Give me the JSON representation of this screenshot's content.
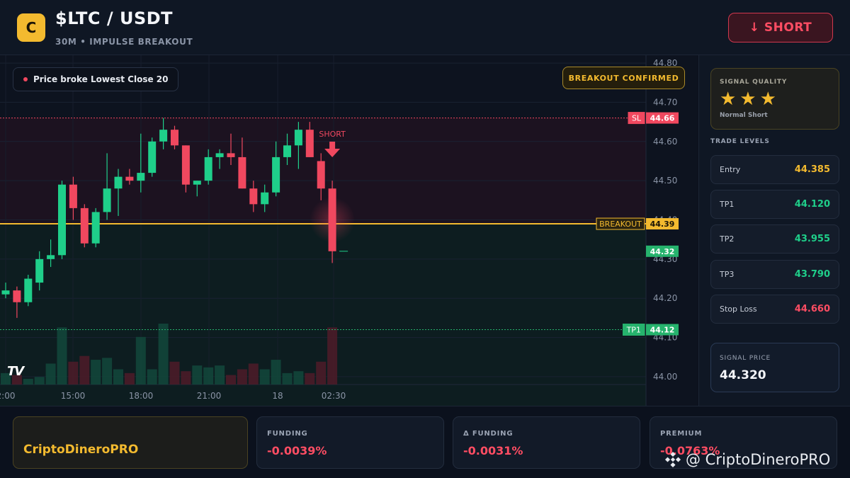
{
  "header": {
    "logo_letter": "C",
    "title": "$LTC / USDT",
    "subtitle": "30M • IMPULSE BREAKOUT",
    "short_button": "↓ SHORT"
  },
  "chart": {
    "signal_badge": "Price broke Lowest Close 20",
    "confirmed_badge": "BREAKOUT CONFIRMED",
    "short_marker": "SHORT",
    "tv_logo": "TV",
    "markers": [
      {
        "label": "SL",
        "value": "44.66",
        "color": "#f0485f"
      },
      {
        "label": "BREAKOUT",
        "value": "44.39",
        "color": "#f3ba2f"
      },
      {
        "label": "",
        "value": "44.32",
        "color": "#26b36d"
      },
      {
        "label": "TP1",
        "value": "44.12",
        "color": "#26b36d"
      }
    ],
    "colors": {
      "up": "#1fcf8a",
      "down": "#f0485f",
      "breakout": "#f3ba2f",
      "sl": "#f0485f",
      "tp": "#26b36d"
    }
  },
  "chart_data": {
    "type": "candlestick",
    "y_ticks": [
      "44.80",
      "44.70",
      "44.60",
      "44.50",
      "44.40",
      "44.30",
      "44.20",
      "44.10",
      "44.00"
    ],
    "ylim": [
      43.98,
      44.82
    ],
    "x_tick_labels": [
      "2:00",
      "15:00",
      "18:00",
      "21:00",
      "18",
      "02:30"
    ],
    "levels": {
      "stop_loss": 44.66,
      "breakout": 44.39,
      "last_price": 44.32,
      "tp1": 44.12
    },
    "candles": [
      {
        "o": 44.21,
        "h": 44.24,
        "l": 44.2,
        "c": 44.22
      },
      {
        "o": 44.22,
        "h": 44.23,
        "l": 44.15,
        "c": 44.19
      },
      {
        "o": 44.19,
        "h": 44.26,
        "l": 44.18,
        "c": 44.25
      },
      {
        "o": 44.24,
        "h": 44.32,
        "l": 44.22,
        "c": 44.3
      },
      {
        "o": 44.3,
        "h": 44.35,
        "l": 44.28,
        "c": 44.31
      },
      {
        "o": 44.31,
        "h": 44.5,
        "l": 44.3,
        "c": 44.49
      },
      {
        "o": 44.49,
        "h": 44.51,
        "l": 44.4,
        "c": 44.43
      },
      {
        "o": 44.43,
        "h": 44.44,
        "l": 44.33,
        "c": 44.34
      },
      {
        "o": 44.34,
        "h": 44.43,
        "l": 44.33,
        "c": 44.42
      },
      {
        "o": 44.42,
        "h": 44.57,
        "l": 44.4,
        "c": 44.48
      },
      {
        "o": 44.48,
        "h": 44.53,
        "l": 44.41,
        "c": 44.51
      },
      {
        "o": 44.51,
        "h": 44.53,
        "l": 44.49,
        "c": 44.5
      },
      {
        "o": 44.5,
        "h": 44.62,
        "l": 44.47,
        "c": 44.52
      },
      {
        "o": 44.52,
        "h": 44.61,
        "l": 44.51,
        "c": 44.6
      },
      {
        "o": 44.6,
        "h": 44.66,
        "l": 44.58,
        "c": 44.63
      },
      {
        "o": 44.63,
        "h": 44.64,
        "l": 44.58,
        "c": 44.59
      },
      {
        "o": 44.59,
        "h": 44.59,
        "l": 44.47,
        "c": 44.49
      },
      {
        "o": 44.49,
        "h": 44.5,
        "l": 44.46,
        "c": 44.5
      },
      {
        "o": 44.5,
        "h": 44.58,
        "l": 44.49,
        "c": 44.56
      },
      {
        "o": 44.56,
        "h": 44.58,
        "l": 44.53,
        "c": 44.57
      },
      {
        "o": 44.57,
        "h": 44.62,
        "l": 44.54,
        "c": 44.56
      },
      {
        "o": 44.56,
        "h": 44.61,
        "l": 44.48,
        "c": 44.48
      },
      {
        "o": 44.48,
        "h": 44.5,
        "l": 44.42,
        "c": 44.44
      },
      {
        "o": 44.44,
        "h": 44.49,
        "l": 44.42,
        "c": 44.47
      },
      {
        "o": 44.47,
        "h": 44.6,
        "l": 44.46,
        "c": 44.56
      },
      {
        "o": 44.56,
        "h": 44.62,
        "l": 44.54,
        "c": 44.59
      },
      {
        "o": 44.59,
        "h": 44.65,
        "l": 44.53,
        "c": 44.63
      },
      {
        "o": 44.63,
        "h": 44.65,
        "l": 44.56,
        "c": 44.56
      },
      {
        "o": 44.55,
        "h": 44.57,
        "l": 44.45,
        "c": 44.48
      },
      {
        "o": 44.48,
        "h": 44.5,
        "l": 44.29,
        "c": 44.32
      }
    ],
    "volume": [
      6,
      5,
      3,
      4,
      11,
      30,
      12,
      15,
      13,
      14,
      8,
      6,
      25,
      8,
      32,
      12,
      7,
      10,
      9,
      10,
      5,
      8,
      11,
      8,
      13,
      6,
      7,
      6,
      12,
      30
    ]
  },
  "panel": {
    "quality_label": "SIGNAL QUALITY",
    "stars": "★★★",
    "quality_sub": "Normal Short",
    "levels_title": "TRADE LEVELS",
    "levels": [
      {
        "name": "Entry",
        "value": "44.385",
        "color": "#f3ba2f"
      },
      {
        "name": "TP1",
        "value": "44.120",
        "color": "#1fcf8a"
      },
      {
        "name": "TP2",
        "value": "43.955",
        "color": "#1fcf8a"
      },
      {
        "name": "TP3",
        "value": "43.790",
        "color": "#1fcf8a"
      },
      {
        "name": "Stop Loss",
        "value": "44.660",
        "color": "#ff4d63"
      }
    ],
    "signal_price_label": "SIGNAL PRICE",
    "signal_price": "44.320"
  },
  "footer": {
    "brand": "CriptoDineroPRO",
    "metrics": [
      {
        "label": "FUNDING",
        "value": "-0.0039%"
      },
      {
        "label": "Δ FUNDING",
        "value": "-0.0031%"
      },
      {
        "label": "PREMIUM",
        "value": "-0.0763%"
      }
    ],
    "watermark": "@ CriptoDineroPRO"
  }
}
